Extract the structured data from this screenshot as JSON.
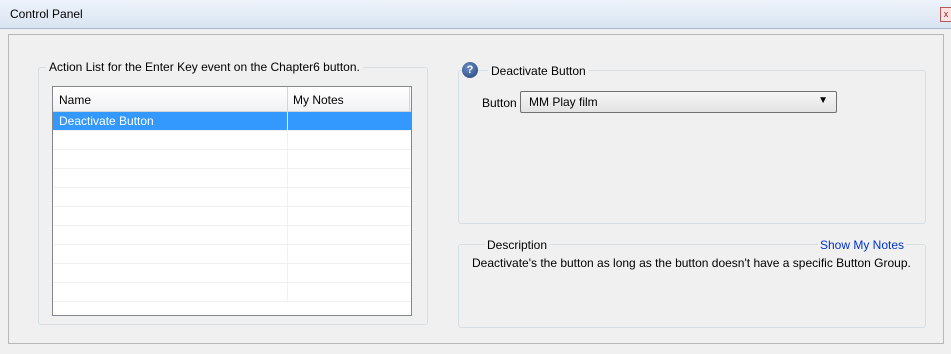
{
  "window": {
    "title": "Control Panel",
    "close_glyph": "x"
  },
  "action_list": {
    "caption": "Action List for the Enter Key event on the Chapter6 button.",
    "columns": [
      "Name",
      "My Notes"
    ],
    "rows": [
      {
        "name": "Deactivate Button",
        "notes": "",
        "selected": true
      },
      {
        "name": "",
        "notes": ""
      },
      {
        "name": "",
        "notes": ""
      },
      {
        "name": "",
        "notes": ""
      },
      {
        "name": "",
        "notes": ""
      },
      {
        "name": "",
        "notes": ""
      },
      {
        "name": "",
        "notes": ""
      },
      {
        "name": "",
        "notes": ""
      },
      {
        "name": "",
        "notes": ""
      },
      {
        "name": "",
        "notes": ""
      }
    ]
  },
  "action_panel": {
    "icon": "help-icon",
    "title": "Deactivate Button",
    "button_label": "Button",
    "button_value": "MM Play film"
  },
  "description": {
    "title": "Description",
    "show_notes_link": "Show My Notes",
    "text": "Deactivate's the button as long as the button doesn't have a specific Button Group."
  },
  "colors": {
    "selection": "#3399ff",
    "link": "#0033cc"
  }
}
